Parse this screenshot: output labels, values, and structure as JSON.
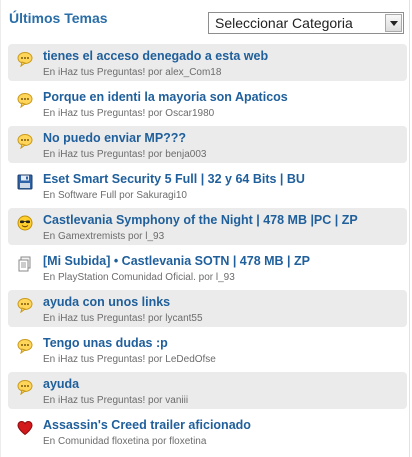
{
  "header": {
    "title": "Últimos Temas"
  },
  "category_select": {
    "value": "Seleccionar Categoria"
  },
  "topics": [
    {
      "title": "tienes el acceso denegado a esta web",
      "meta": "En iHaz tus Preguntas! por alex_Com18",
      "icon": "speech-bubble-icon"
    },
    {
      "title": "Porque en identi la mayoria son Apaticos",
      "meta": "En iHaz tus Preguntas! por Oscar1980",
      "icon": "speech-bubble-icon"
    },
    {
      "title": "No puedo enviar MP???",
      "meta": "En iHaz tus Preguntas! por benja003",
      "icon": "speech-bubble-icon"
    },
    {
      "title": "Eset Smart Security 5 Full | 32 y 64 Bits | BU",
      "meta": "En Software Full por Sakuragi10",
      "icon": "floppy-disk-icon"
    },
    {
      "title": "Castlevania Symphony of the Night | 478 MB |PC | ZP",
      "meta": "En Gamextremists por l_93",
      "icon": "sunglasses-smiley-icon"
    },
    {
      "title": "[Mi Subida] • Castlevania SOTN | 478 MB | ZP",
      "meta": "En PlayStation Comunidad Oficial. por l_93",
      "icon": "document-icon"
    },
    {
      "title": "ayuda con unos links",
      "meta": "En iHaz tus Preguntas! por lycant55",
      "icon": "speech-bubble-icon"
    },
    {
      "title": "Tengo unas dudas :p",
      "meta": "En iHaz tus Preguntas! por LeDedOfse",
      "icon": "speech-bubble-icon"
    },
    {
      "title": "ayuda",
      "meta": "En iHaz tus Preguntas! por vaniii",
      "icon": "speech-bubble-icon"
    },
    {
      "title": "Assassin's Creed trailer aficionado",
      "meta": "En Comunidad floxetina por floxetina",
      "icon": "heart-icon"
    }
  ]
}
